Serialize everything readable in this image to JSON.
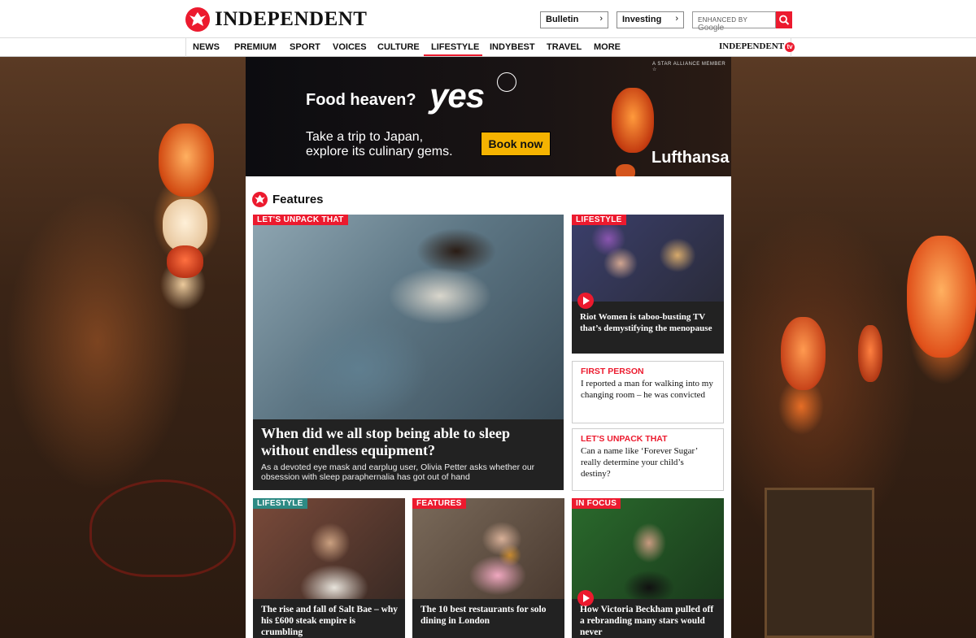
{
  "header": {
    "logo_text": "INDEPENDENT",
    "bulletin_label": "Bulletin",
    "investing_label": "Investing",
    "search_prefix": "ENHANCED BY",
    "search_brand": "Google"
  },
  "nav": {
    "items": [
      "NEWS",
      "PREMIUM",
      "SPORT",
      "VOICES",
      "CULTURE",
      "LIFESTYLE",
      "INDYBEST",
      "TRAVEL",
      "MORE"
    ],
    "active": "LIFESTYLE",
    "tv_label": "INDEPENDENT",
    "tv_badge": "tv"
  },
  "ad": {
    "star_alliance": "A STAR ALLIANCE MEMBER",
    "headline": "Food heaven?",
    "yes": "yes",
    "sub_line1": "Take a trip to Japan,",
    "sub_line2": "explore its culinary gems.",
    "cta": "Book now",
    "brand": "Lufthansa"
  },
  "features": {
    "section_title": "Features",
    "main": {
      "tag": "LET'S UNPACK THAT",
      "title": "When did we all stop being able to sleep without endless equipment?",
      "desc": "As a devoted eye mask and earplug user, Olivia Petter asks whether our obsession with sleep paraphernalia has got out of hand"
    },
    "side_video": {
      "tag": "LIFESTYLE",
      "title": "Riot Women is taboo-busting TV that’s demystifying the menopause"
    },
    "box1": {
      "kicker": "FIRST PERSON",
      "title": "I reported a man for walking into my changing room – he was convicted"
    },
    "box2": {
      "kicker": "LET'S UNPACK THAT",
      "title": "Can a name like ‘Forever Sugar’ really determine your child’s destiny?"
    },
    "bottom": [
      {
        "tag": "LIFESTYLE",
        "title": "The rise and fall of Salt Bae – why his £600 steak empire is crumbling"
      },
      {
        "tag": "FEATURES",
        "title": "The 10 best restaurants for solo dining in London"
      },
      {
        "tag": "IN FOCUS",
        "title": "How Victoria Beckham pulled off a rebranding many stars would never"
      }
    ]
  },
  "colors": {
    "brand_red": "#ec1a2e",
    "teal_tag": "#2d8a84",
    "cta_yellow": "#f5b301"
  }
}
